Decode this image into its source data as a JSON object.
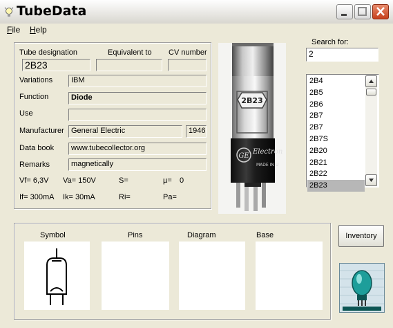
{
  "window": {
    "title": "TubeData"
  },
  "menu": {
    "file": "File",
    "help": "Help"
  },
  "header": {
    "designation_label": "Tube designation",
    "equivalent_label": "Equivalent to",
    "cv_label": "CV number",
    "designation_value": "2B23",
    "equivalent_value": "",
    "cv_value": ""
  },
  "details": {
    "variations_label": "Variations",
    "variations_value": "IBM",
    "function_label": "Function",
    "function_value": "Diode",
    "use_label": "Use",
    "use_value": "",
    "manufacturer_label": "Manufacturer",
    "manufacturer_value": "General Electric",
    "year_value": "1946",
    "databook_label": "Data book",
    "databook_value": "www.tubecollector.org",
    "remarks_label": "Remarks",
    "remarks_value": "magnetically"
  },
  "params": {
    "vf": "Vf= 6,3V",
    "va": "Va= 150V",
    "s": "S=",
    "mu": "µ=",
    "mu_value": "0",
    "if": "If= 300mA",
    "ik": "Ik= 30mA",
    "ri": "Ri=",
    "pa": "Pa="
  },
  "photo": {
    "glass_label": "2B23",
    "brand_script": "Electron",
    "made_in": "MADE IN U"
  },
  "search": {
    "label": "Search for:",
    "value": "2"
  },
  "tube_list": {
    "items": [
      "2B4",
      "2B5",
      "2B6",
      "2B7",
      "2B7",
      "2B7S",
      "2B20",
      "2B21",
      "2B22",
      "2B23"
    ],
    "selected_index": 9
  },
  "bottom": {
    "symbol": "Symbol",
    "pins": "Pins",
    "diagram": "Diagram",
    "base": "Base"
  },
  "inventory_button": "Inventory"
}
